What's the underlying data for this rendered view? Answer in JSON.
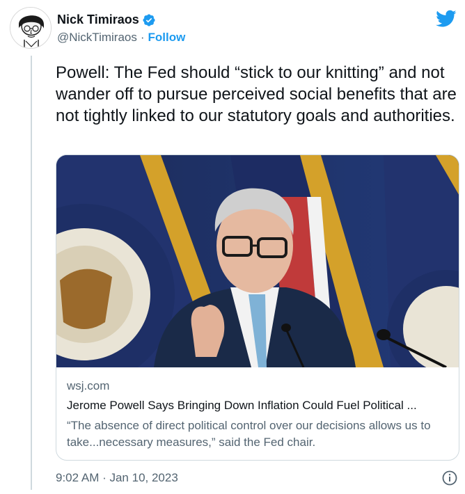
{
  "author": {
    "display_name": "Nick Timiraos",
    "handle": "@NickTimiraos",
    "separator": "·",
    "follow_label": "Follow",
    "verified": true
  },
  "tweet": {
    "text": "Powell: The Fed should “stick to our knitting” and not wander off to pursue perceived social benefits that are not tightly linked to our statutory goals and authorities."
  },
  "link_card": {
    "domain": "wsj.com",
    "title": "Jerome Powell Says Bringing Down Inflation Could Fuel Political ...",
    "description": "“The absence of direct political control over our decisions allows us to take...necessary measures,” said the Fed chair.",
    "image_alt": "Jerome Powell speaking in front of flags and Federal Reserve Board seals"
  },
  "footer": {
    "timestamp": "9:02 AM · Jan 10, 2023"
  },
  "colors": {
    "accent": "#1d9bf0",
    "text_primary": "#0f1419",
    "text_secondary": "#536471",
    "border": "#cfd9de"
  },
  "icons": [
    "verified-icon",
    "twitter-bird-icon",
    "info-icon"
  ]
}
